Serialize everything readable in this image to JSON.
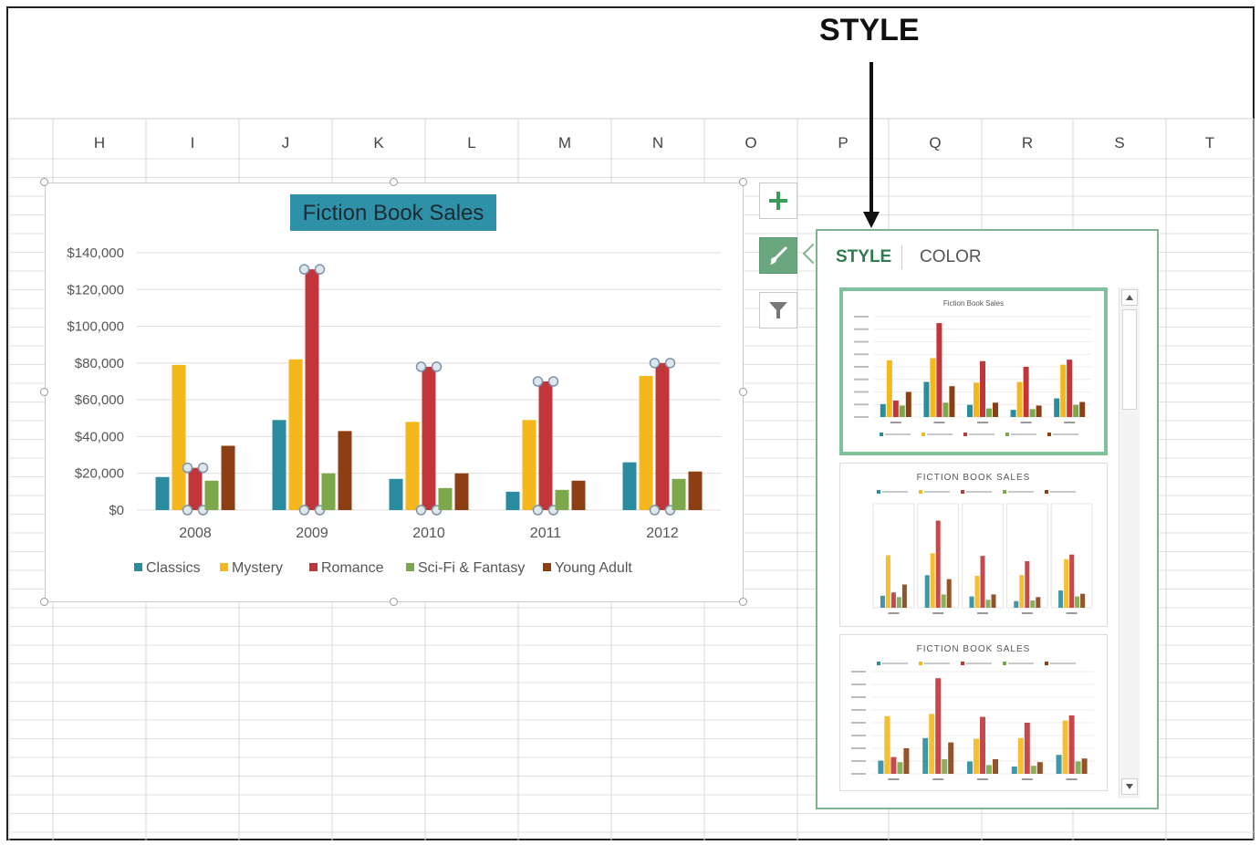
{
  "annotation": {
    "label": "STYLE"
  },
  "sheet": {
    "column_headers": [
      "H",
      "I",
      "J",
      "K",
      "L",
      "M",
      "N",
      "O",
      "P",
      "Q",
      "R",
      "S",
      "T"
    ]
  },
  "chart_data": {
    "type": "bar",
    "title": "Fiction Book Sales",
    "categories": [
      "2008",
      "2009",
      "2010",
      "2011",
      "2012"
    ],
    "y_tick_labels": [
      "$140,000",
      "$120,000",
      "$100,000",
      "$80,000",
      "$60,000",
      "$40,000",
      "$20,000",
      "$0"
    ],
    "ylim": [
      0,
      140000
    ],
    "grid": true,
    "legend_position": "bottom",
    "series": [
      {
        "name": "Classics",
        "color": "#2b8ca0",
        "values": [
          18000,
          49000,
          17000,
          10000,
          26000
        ]
      },
      {
        "name": "Mystery",
        "color": "#f5b81c",
        "values": [
          79000,
          82000,
          48000,
          49000,
          73000
        ]
      },
      {
        "name": "Romance",
        "color": "#c0363a",
        "values": [
          23000,
          131000,
          78000,
          70000,
          80000
        ]
      },
      {
        "name": "Sci-Fi & Fantasy",
        "color": "#7aa84a",
        "values": [
          16000,
          20000,
          12000,
          11000,
          17000
        ]
      },
      {
        "name": "Young Adult",
        "color": "#8b3f12",
        "values": [
          35000,
          43000,
          20000,
          16000,
          21000
        ]
      }
    ],
    "selected_series": "Romance"
  },
  "side_buttons": [
    {
      "name": "chart-elements-button",
      "icon": "plus-icon"
    },
    {
      "name": "chart-styles-button",
      "icon": "paintbrush-icon",
      "active": true
    },
    {
      "name": "chart-filters-button",
      "icon": "filter-icon"
    }
  ],
  "style_pane": {
    "tabs": [
      "STYLE",
      "COLOR"
    ],
    "active_tab": "STYLE",
    "thumbnails": [
      {
        "title": "Fiction Book Sales",
        "selected": true
      },
      {
        "title": "FICTION BOOK SALES",
        "selected": false
      },
      {
        "title": "FICTION BOOK SALES",
        "selected": false
      }
    ]
  },
  "colors": {
    "accent_green": "#6aa77e",
    "pane_border": "#7fb58e",
    "title_highlight": "#2f91a7"
  }
}
